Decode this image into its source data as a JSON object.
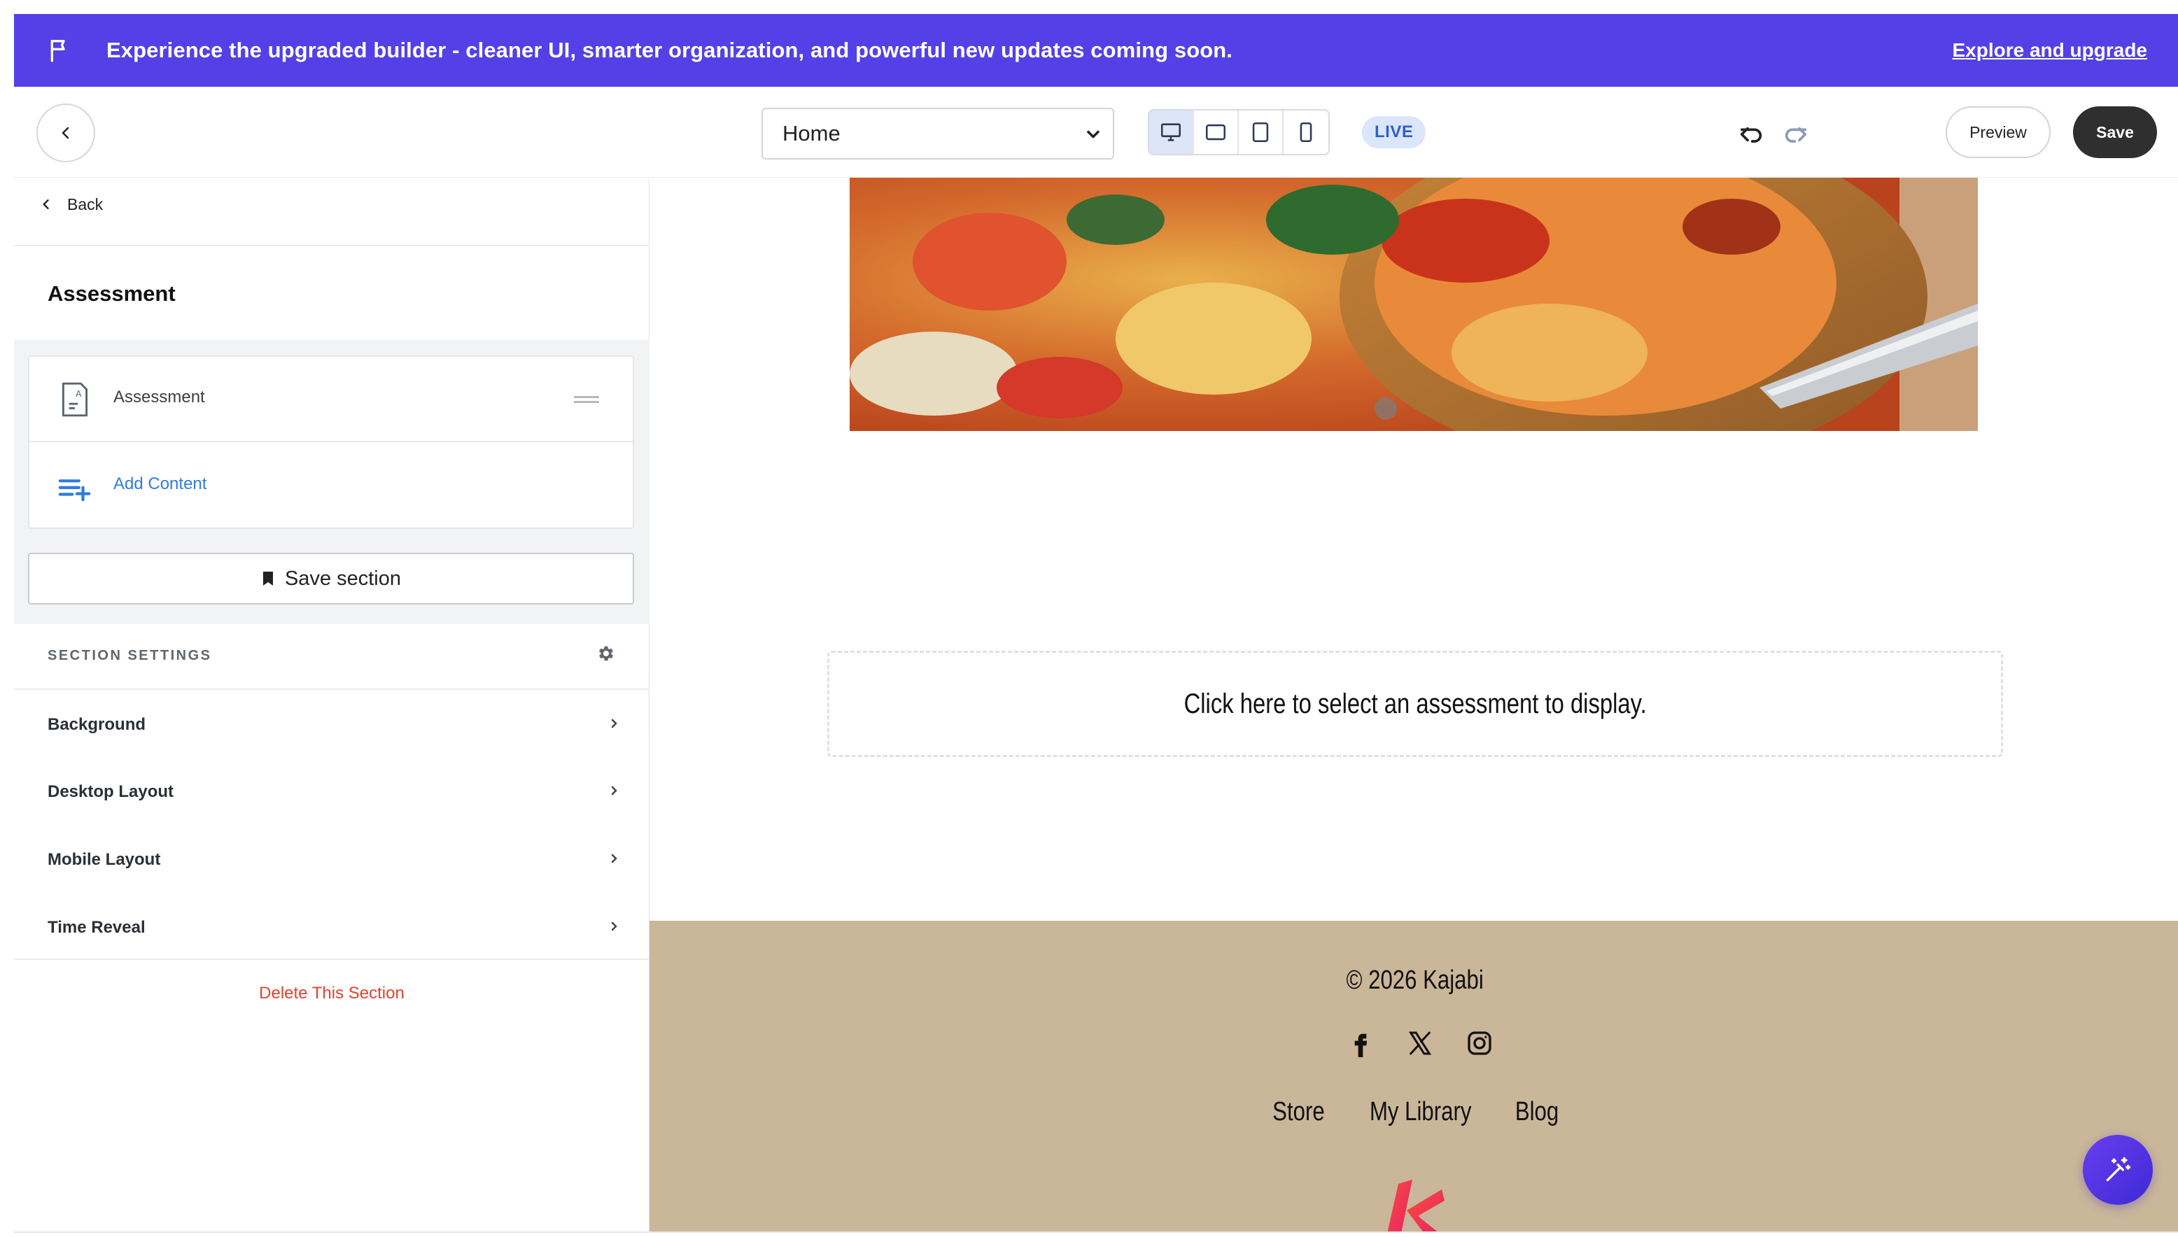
{
  "banner": {
    "message": "Experience the upgraded builder - cleaner UI, smarter organization, and powerful new updates coming soon.",
    "cta": "Explore and upgrade",
    "icon": "flag-icon",
    "background_color": "#5340e6"
  },
  "toolbar": {
    "page_select": {
      "value": "Home"
    },
    "devices": [
      "desktop",
      "tablet-landscape",
      "tablet-portrait",
      "mobile"
    ],
    "active_device": "desktop",
    "live_badge": "LIVE",
    "preview_label": "Preview",
    "save_label": "Save"
  },
  "sidebar": {
    "back_label": "Back",
    "title": "Assessment",
    "content_items": [
      {
        "label": "Assessment",
        "icon": "assessment-document-icon"
      },
      {
        "label": "Add Content",
        "icon": "add-content-icon"
      }
    ],
    "save_section_label": "Save section",
    "settings_header": "SECTION SETTINGS",
    "settings": [
      {
        "label": "Background"
      },
      {
        "label": "Desktop Layout"
      },
      {
        "label": "Mobile Layout"
      },
      {
        "label": "Time Reveal"
      }
    ],
    "delete_label": "Delete This Section"
  },
  "canvas": {
    "assessment_placeholder": "Click here to select an assessment to display.",
    "footer": {
      "copyright": "© 2026 Kajabi",
      "socials": [
        "facebook-icon",
        "x-icon",
        "instagram-icon"
      ],
      "nav": [
        "Store",
        "My Library",
        "Blog"
      ],
      "background_color": "#cab699"
    }
  },
  "colors": {
    "accent": "#5340e6",
    "link_blue": "#2f7be0",
    "danger": "#e0432b",
    "save_button": "#2f2f2f"
  }
}
